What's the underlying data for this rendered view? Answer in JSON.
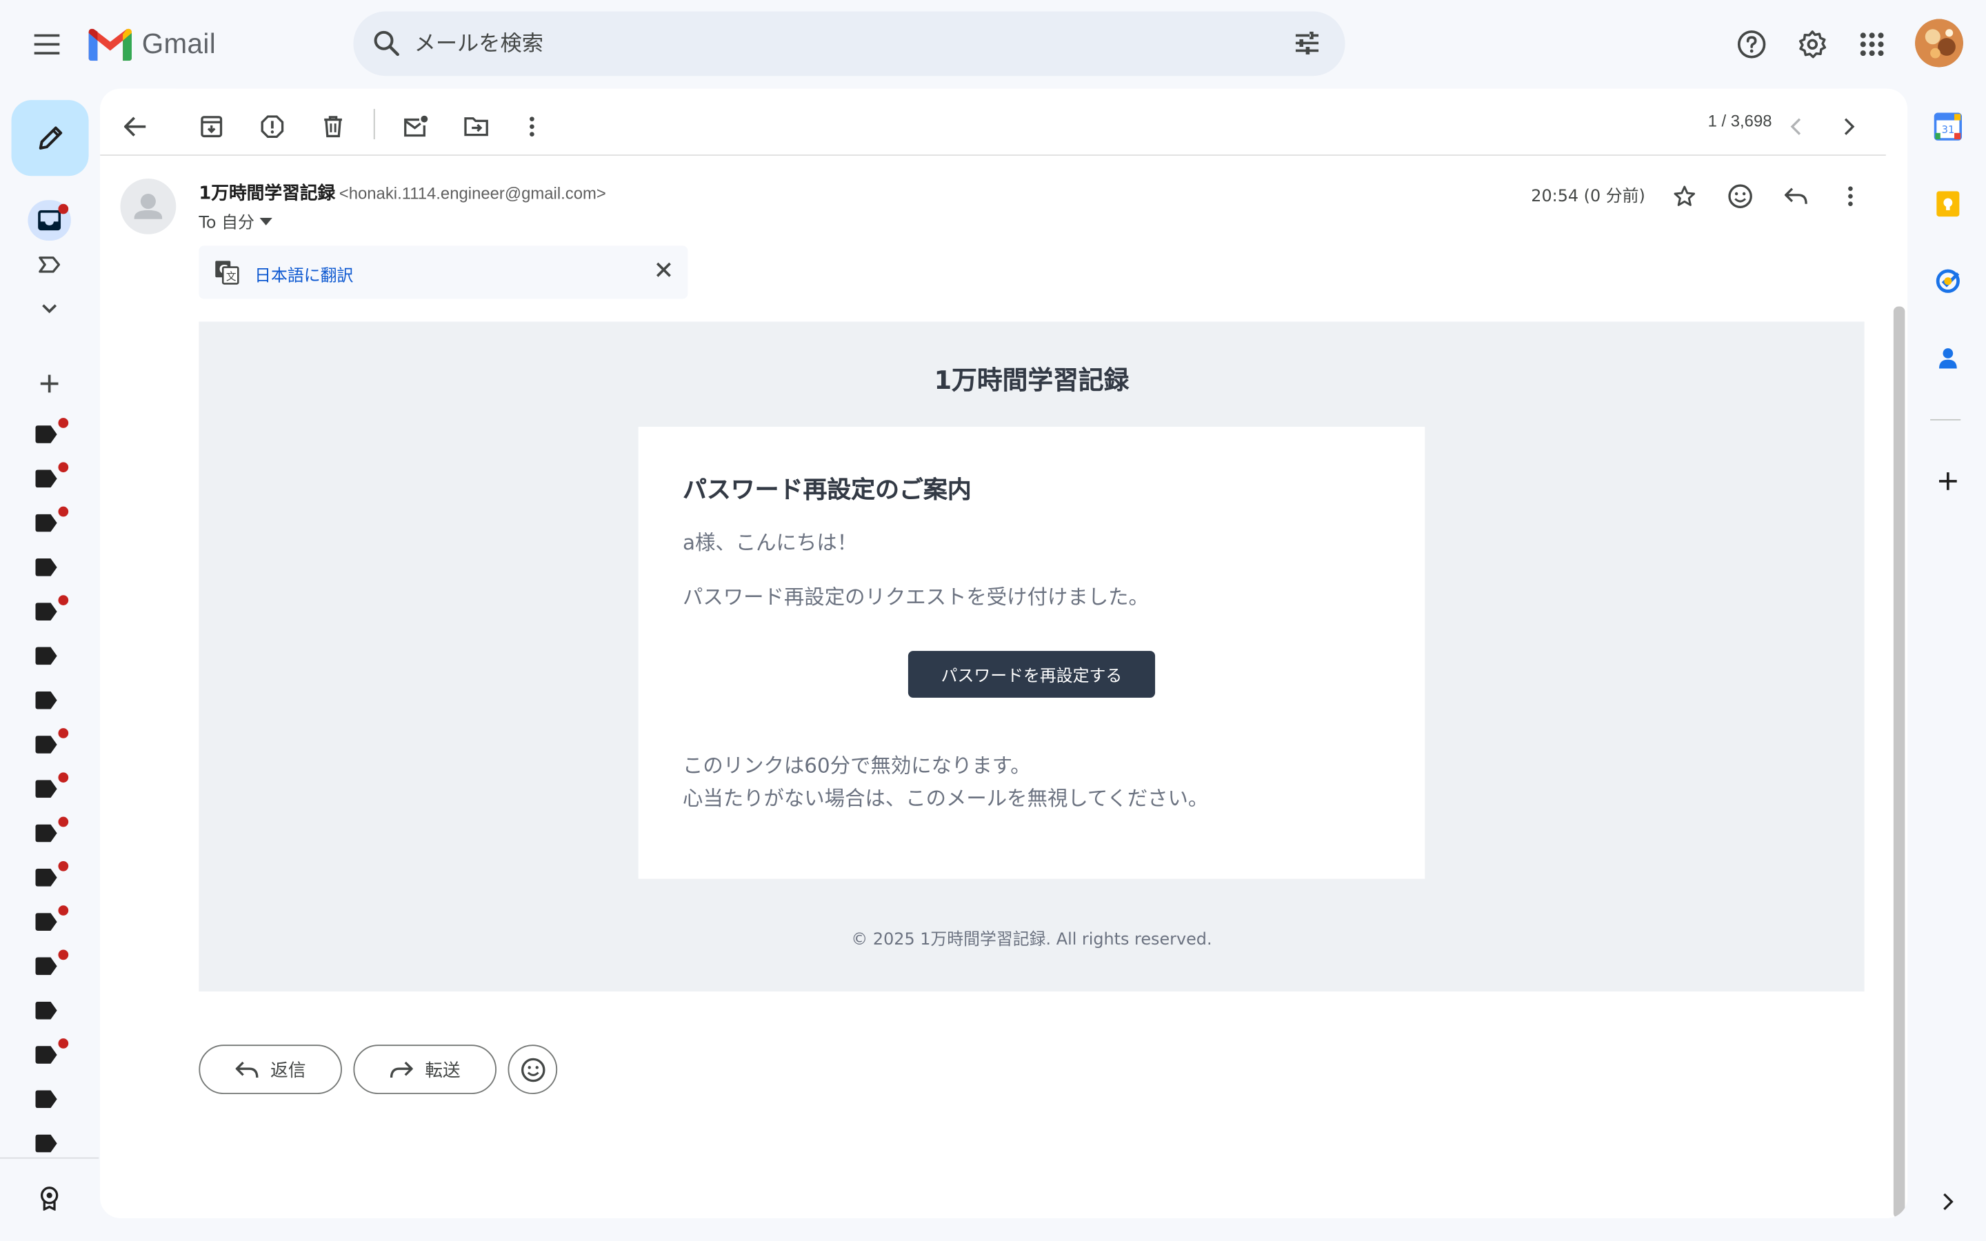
{
  "app": {
    "logo_text": "Gmail"
  },
  "search": {
    "placeholder": "メールを検索"
  },
  "toolbar": {
    "pager": "1 / 3,698"
  },
  "message": {
    "sender_name": "1万時間学習記録",
    "sender_email": "<honaki.1114.engineer@gmail.com>",
    "to_label": "To 自分",
    "time": "20:54 (0 分前)",
    "translate_label": "日本語に翻訳"
  },
  "email": {
    "brand": "1万時間学習記録",
    "title": "パスワード再設定のご案内",
    "greeting": "a様、こんにちは！",
    "request_text": "パスワード再設定のリクエストを受け付けました。",
    "button_label": "パスワードを再設定する",
    "expiry_text": "このリンクは60分で無効になります。",
    "ignore_text": "心当たりがない場合は、このメールを無視してください。",
    "footer": "© 2025 1万時間学習記録. All rights reserved."
  },
  "actions": {
    "reply_label": "返信",
    "forward_label": "転送"
  },
  "colors": {
    "accent": "#0b57d0",
    "compose_bg": "#c2e7ff",
    "unread_dot": "#c5221f",
    "email_button": "#2e3a4b",
    "email_bg": "#eef1f4"
  },
  "icons": {
    "top": [
      "menu-icon",
      "gmail-logo",
      "search-icon",
      "tune-icon",
      "help-icon",
      "gear-icon",
      "apps-grid-icon",
      "account-avatar"
    ],
    "rail": [
      "pencil-icon",
      "inbox-icon",
      "label-important-icon",
      "chevron-down-icon",
      "plus-icon",
      "label-icon",
      "award-icon"
    ],
    "side": [
      "calendar-icon",
      "keep-icon",
      "tasks-icon",
      "contacts-icon",
      "plus-icon",
      "chevron-right-icon"
    ]
  }
}
